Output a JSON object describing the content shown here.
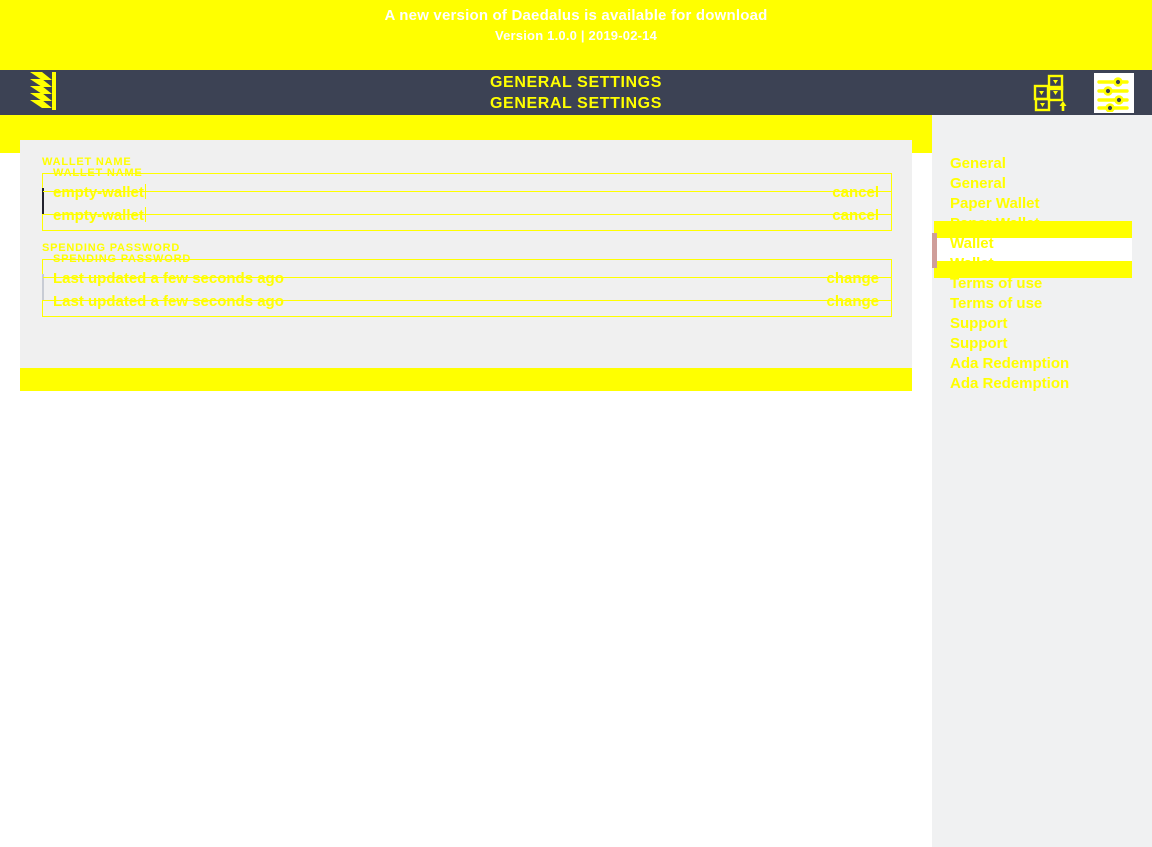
{
  "news_banner": {
    "headline": "A new version of Daedalus is available for download",
    "subline": "Version 1.0.0 | 2019-02-14",
    "text_color": "#ffffff",
    "background": "#ffff00"
  },
  "topbar": {
    "title": "GENERAL SETTINGS",
    "title_echo": "GENERAL SETTINGS",
    "background": "#3c4254",
    "accent_color": "#ffff00",
    "logo_name": "daedalus-logo",
    "icons": [
      {
        "name": "wallets-grid-icon",
        "label": "Wallets",
        "active": false
      },
      {
        "name": "settings-sliders-icon",
        "label": "Settings",
        "active": true
      }
    ]
  },
  "settings": {
    "background": "#f0f0f0",
    "fields": [
      {
        "name": "wallet-name",
        "label": "WALLET NAME",
        "label_echo": "WALLET NAME",
        "value": "empty-wallet",
        "value_echo": "empty-wallet",
        "action": "cancel",
        "action_echo": "cancel",
        "caret": "dark"
      },
      {
        "name": "spending-password",
        "label": "SPENDING PASSWORD",
        "label_echo": "SPENDING PASSWORD",
        "value": "Last updated a few seconds ago",
        "value_echo": "Last updated a few seconds ago",
        "action": "change",
        "action_echo": "change",
        "caret": "grey"
      }
    ]
  },
  "sidebar": {
    "background": "#f0f1f2",
    "active_accent": "#cf9e9a",
    "items": [
      {
        "name": "sidebar-item-general",
        "label": "General",
        "label_echo": "General",
        "active": false
      },
      {
        "name": "sidebar-item-paper-wallet",
        "label": "Paper Wallet",
        "label_echo": "Paper Wallet",
        "active": false
      },
      {
        "name": "sidebar-item-wallet",
        "label": "Wallet",
        "label_echo": "Wallet",
        "active": true
      },
      {
        "name": "sidebar-item-terms-of-use",
        "label": "Terms of use",
        "label_echo": "Terms of use",
        "active": false
      },
      {
        "name": "sidebar-item-support",
        "label": "Support",
        "label_echo": "Support",
        "active": false
      },
      {
        "name": "sidebar-item-ada-redemption",
        "label": "Ada Redemption",
        "label_echo": "Ada Redemption",
        "active": false
      }
    ]
  }
}
